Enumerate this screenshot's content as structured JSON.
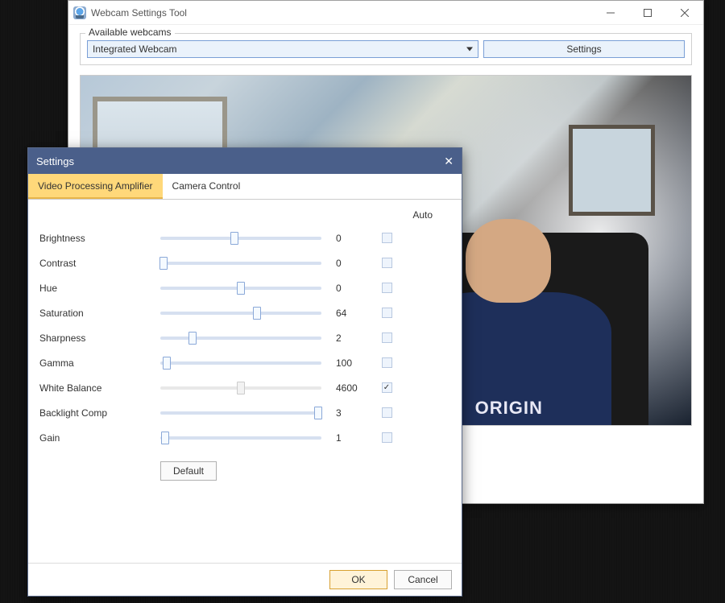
{
  "main_window": {
    "title": "Webcam Settings Tool",
    "fieldset_label": "Available webcams",
    "selected_webcam": "Integrated Webcam",
    "settings_button": "Settings"
  },
  "settings_dialog": {
    "title": "Settings",
    "tabs": {
      "video_proc_amp": "Video Processing Amplifier",
      "camera_control": "Camera Control"
    },
    "auto_header": "Auto",
    "sliders": [
      {
        "label": "Brightness",
        "value": "0",
        "pos": 0.46,
        "auto": false,
        "disabled": false,
        "auto_enabled": true
      },
      {
        "label": "Contrast",
        "value": "0",
        "pos": 0.02,
        "auto": false,
        "disabled": false,
        "auto_enabled": true
      },
      {
        "label": "Hue",
        "value": "0",
        "pos": 0.5,
        "auto": false,
        "disabled": false,
        "auto_enabled": true
      },
      {
        "label": "Saturation",
        "value": "64",
        "pos": 0.6,
        "auto": false,
        "disabled": false,
        "auto_enabled": true
      },
      {
        "label": "Sharpness",
        "value": "2",
        "pos": 0.2,
        "auto": false,
        "disabled": false,
        "auto_enabled": true
      },
      {
        "label": "Gamma",
        "value": "100",
        "pos": 0.04,
        "auto": false,
        "disabled": false,
        "auto_enabled": true
      },
      {
        "label": "White Balance",
        "value": "4600",
        "pos": 0.5,
        "auto": true,
        "disabled": true,
        "auto_enabled": true
      },
      {
        "label": "Backlight Comp",
        "value": "3",
        "pos": 0.98,
        "auto": false,
        "disabled": false,
        "auto_enabled": true
      },
      {
        "label": "Gain",
        "value": "1",
        "pos": 0.03,
        "auto": false,
        "disabled": false,
        "auto_enabled": true
      }
    ],
    "default_button": "Default",
    "ok_button": "OK",
    "cancel_button": "Cancel"
  }
}
